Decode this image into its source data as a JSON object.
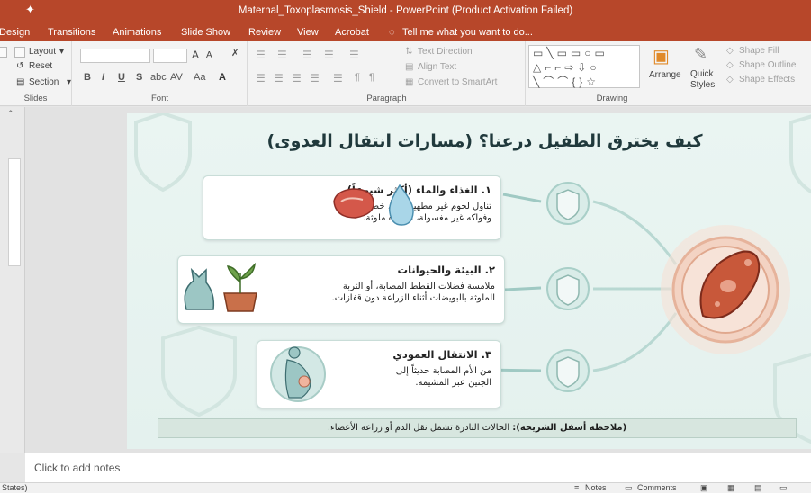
{
  "window": {
    "title": "Maternal_Toxoplasmosis_Shield - PowerPoint (Product Activation Failed)",
    "accent_color": "#b7472a"
  },
  "tabs": [
    "Design",
    "Transitions",
    "Animations",
    "Slide Show",
    "Review",
    "View",
    "Acrobat"
  ],
  "tell_me": "Tell me what you want to do...",
  "ribbon": {
    "slides": {
      "layout": "Layout",
      "reset": "Reset",
      "section": "Section",
      "label": "Slides"
    },
    "font": {
      "label": "Font",
      "bold": "B",
      "italic": "I",
      "underline": "U",
      "strike": "S",
      "shadow": "abc",
      "spacing": "AV",
      "case": "Aa",
      "grow": "A",
      "shrink": "A"
    },
    "paragraph": {
      "label": "Paragraph",
      "text_direction": "Text Direction",
      "align_text": "Align Text",
      "convert": "Convert to SmartArt"
    },
    "drawing": {
      "label": "Drawing",
      "arrange": "Arrange",
      "quick_styles": "Quick Styles",
      "shape_fill": "Shape Fill",
      "shape_outline": "Shape Outline",
      "shape_effects": "Shape Effects"
    }
  },
  "slide": {
    "title": "كيف يخترق الطفيل درعنا؟ (مسارات انتقال العدوى)",
    "routes": [
      {
        "title": "١. الغذاء والماء (أكثر شيوعاً)",
        "desc": [
          "تناول لحوم غير مطهية جيداً، خضروات",
          "وفواكه غير مغسولة، أو مياه ملوثة."
        ]
      },
      {
        "title": "٢. البيئة والحيوانات",
        "desc": [
          "ملامسة فضلات القطط المصابة، أو التربة",
          "الملوثة بالبويضات أثناء الزراعة دون قفازات."
        ]
      },
      {
        "title": "٣. الانتقال العمودي",
        "desc": [
          "من الأم المصابة حديثاً إلى",
          "الجنين عبر المشيمة."
        ]
      }
    ],
    "note_label": "(ملاحظة أسفل الشريحة):",
    "note_text": "الحالات النادرة تشمل نقل الدم أو زراعة الأعضاء."
  },
  "notes_placeholder": "Click to add notes",
  "status": {
    "left": "States)",
    "notes": "Notes",
    "comments": "Comments"
  }
}
